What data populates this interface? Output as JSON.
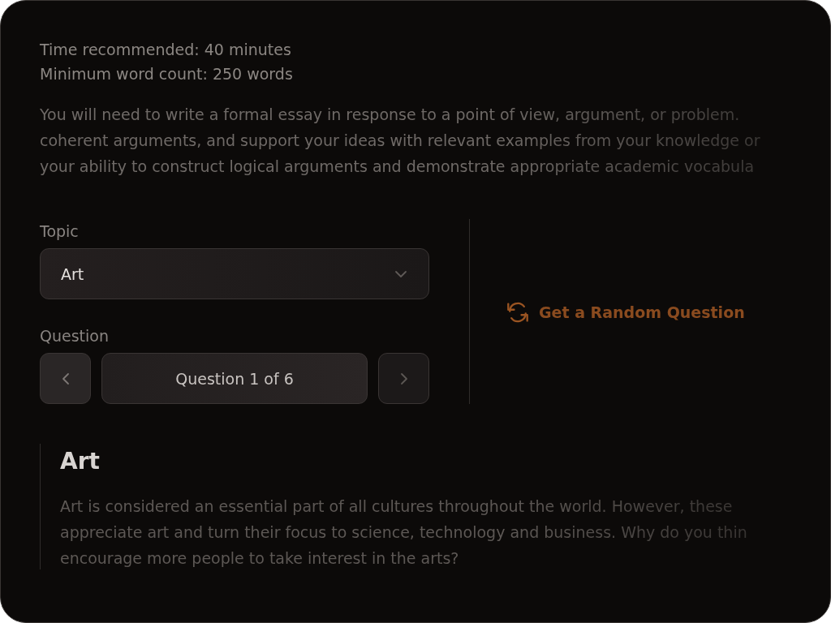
{
  "requirements": [
    "Time recommended: 40 minutes",
    "Minimum word count: 250 words"
  ],
  "description_lines": [
    "You will need to write a formal essay in response to a point of view, argument, or problem.",
    "coherent arguments, and support your ideas with relevant examples from your knowledge or",
    "your ability to construct logical arguments and demonstrate appropriate academic vocabula"
  ],
  "topic": {
    "label": "Topic",
    "value": "Art"
  },
  "question_nav": {
    "label": "Question",
    "current": "Question 1 of 6"
  },
  "random_button": {
    "label": "Get a Random Question"
  },
  "question": {
    "title": "Art",
    "lines": [
      "Art is considered an essential part of all cultures throughout the world. However, these",
      "appreciate art and turn their focus to science, technology and business. Why do you thin",
      "encourage more people to take interest in the arts?"
    ]
  }
}
